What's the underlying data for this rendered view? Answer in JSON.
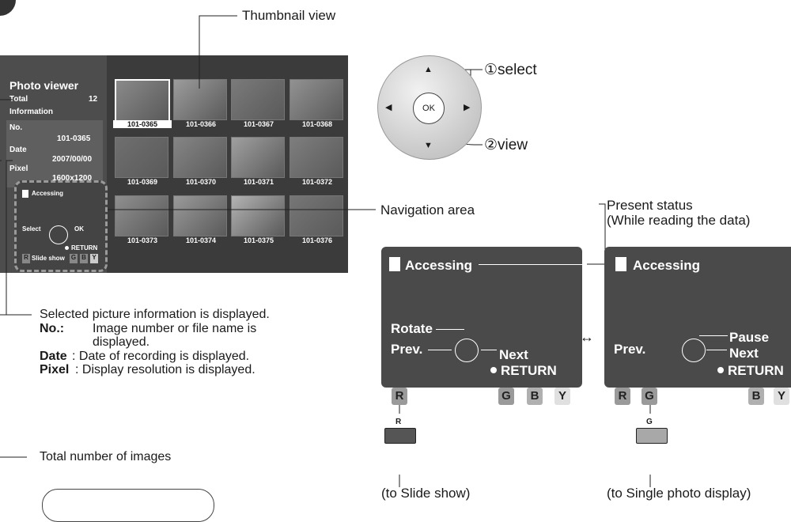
{
  "callouts": {
    "thumbnail_view": "Thumbnail view",
    "navigation_area": "Navigation area",
    "present_status_line1": "Present status",
    "present_status_line2": "(While reading the data)",
    "total_images": "Total number of images",
    "to_slide_show": "(to Slide show)",
    "to_single": "(to Single photo display)"
  },
  "tv": {
    "title": "Photo viewer",
    "total_label": "Total",
    "total_value": "12",
    "information_label": "Information",
    "no_label": "No.",
    "no_value": "101-0365",
    "date_label": "Date",
    "date_value": "2007/00/00",
    "pixel_label": "Pixel",
    "pixel_value": "1600x1200",
    "nav": {
      "accessing": "Accessing",
      "select": "Select",
      "ok": "OK",
      "return": "RETURN",
      "r": "R",
      "slide_show": "Slide show",
      "g": "G",
      "b": "B",
      "y": "Y"
    },
    "thumbnails": [
      "101-0365",
      "101-0366",
      "101-0367",
      "101-0368",
      "101-0369",
      "101-0370",
      "101-0371",
      "101-0372",
      "101-0373",
      "101-0374",
      "101-0375",
      "101-0376"
    ]
  },
  "remote": {
    "ok": "OK",
    "select_label": "①select",
    "view_label": "②view"
  },
  "info_desc": {
    "intro": "Selected picture information is displayed.",
    "no_term": "No.:",
    "no_text1": "Image number or file name is",
    "no_text2": "displayed.",
    "date_term": "Date",
    "date_text": ": Date of recording is displayed.",
    "pixel_term": "Pixel",
    "pixel_text": ": Display resolution is displayed."
  },
  "panel_left": {
    "accessing": "Accessing",
    "rotate": "Rotate",
    "prev": "Prev.",
    "next": "Next",
    "return": "RETURN",
    "r": "R",
    "slide_show": "Slide show",
    "g": "G",
    "b": "B",
    "y": "Y",
    "key_label": "R"
  },
  "panel_right": {
    "accessing": "Accessing",
    "pause": "Pause",
    "prev": "Prev.",
    "next": "Next",
    "return": "RETURN",
    "r": "R",
    "g": "G",
    "single": "Single",
    "b": "B",
    "y": "Y",
    "key_label": "G"
  },
  "arrows": {
    "double": "↔"
  },
  "colors": {
    "panel": "#4a4a4a",
    "key_light": "#d0d0d0",
    "key_mid": "#9a9a9a"
  }
}
